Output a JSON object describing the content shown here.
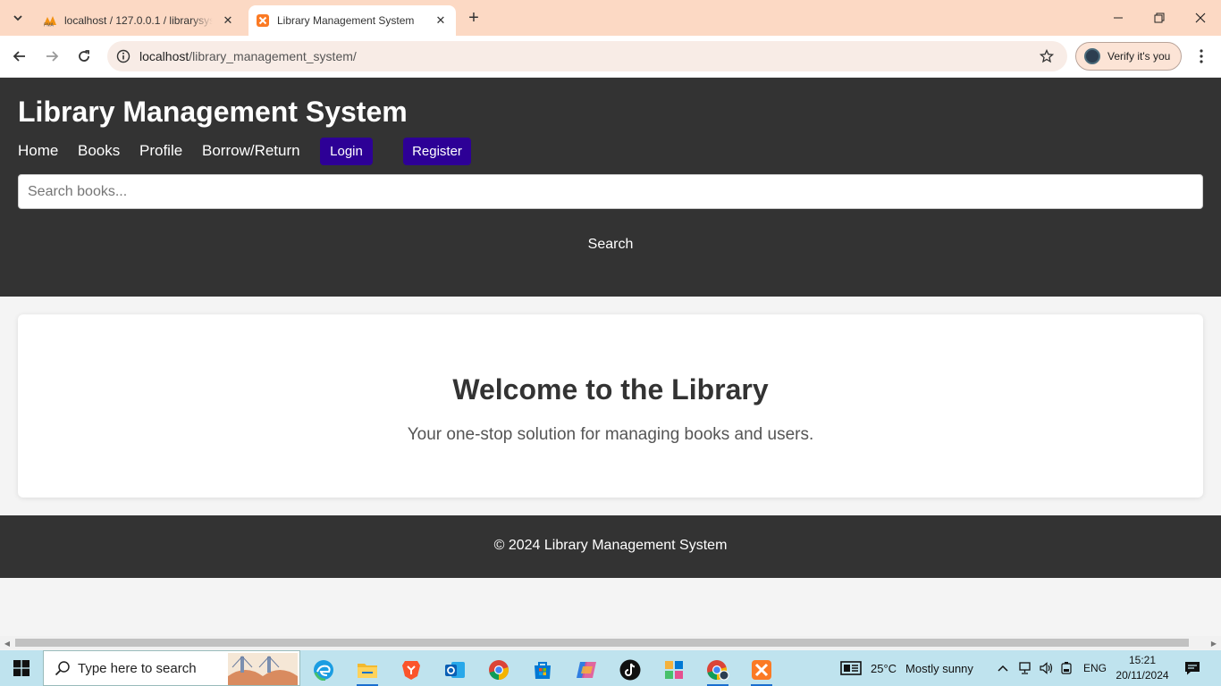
{
  "browser": {
    "tabs": [
      {
        "title": "localhost / 127.0.0.1 / librarysys",
        "favicon": "phpmyadmin-icon"
      },
      {
        "title": "Library Management System",
        "favicon": "xampp-icon"
      }
    ],
    "url_host": "localhost",
    "url_path": "/library_management_system/",
    "verify_label": "Verify it's you"
  },
  "site": {
    "title": "Library Management System",
    "nav": [
      "Home",
      "Books",
      "Profile",
      "Borrow/Return"
    ],
    "login_label": "Login",
    "register_label": "Register",
    "search_placeholder": "Search books...",
    "search_label": "Search"
  },
  "welcome": {
    "heading": "Welcome to the Library",
    "subtext": "Your one-stop solution for managing books and users."
  },
  "footer": {
    "text": "© 2024 Library Management System"
  },
  "taskbar": {
    "search_placeholder": "Type here to search",
    "weather_temp": "25°C",
    "weather_desc": "Mostly sunny",
    "language": "ENG",
    "time": "15:21",
    "date": "20/11/2024",
    "apps": [
      "edge-icon",
      "file-explorer-icon",
      "brave-icon",
      "outlook-icon",
      "chrome-icon",
      "microsoft-store-icon",
      "copilot-icon",
      "tiktok-icon",
      "apps-grid-icon",
      "chrome-profile-icon",
      "xampp-icon"
    ]
  },
  "colors": {
    "header_bg": "#333333",
    "button_bg": "#2d0096",
    "tabbar_bg": "#fcd9c4",
    "taskbar_bg": "#bfe3ee"
  }
}
